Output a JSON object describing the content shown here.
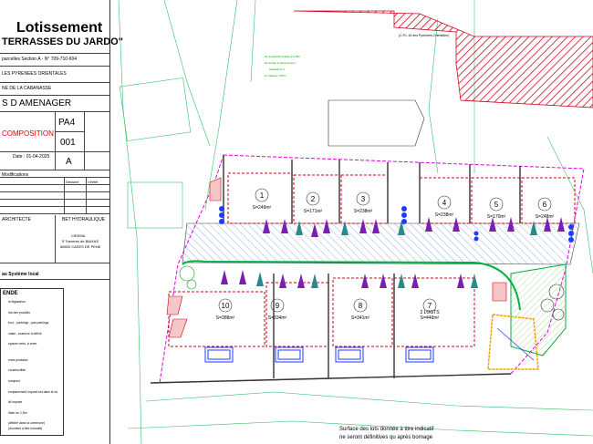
{
  "title": "Lotissement",
  "subtitle": "TERRASSES DU JARDO\"",
  "cadastre": "parcelles Section A - N° 709-710-604",
  "departement": "LES PYRENEES ORIENTALES",
  "commune": "NE DE LA CABANASSE",
  "plan_type": "S D AMENAGER",
  "plan_code": "PA4",
  "plan_subject": "COMPOSITION",
  "plan_number": "001",
  "plan_date": "Date : 01-04-2025",
  "revision": "A",
  "modifications_label": "Modifications",
  "dessine_label": "Dessiné",
  "verifie_label": "Vérifié",
  "architecte_label": "ARCHITECTE",
  "bet_label": "BET HYDRAULIQUE",
  "bet_name": "CIEEMA",
  "bet_address1": "5 Traverse de BAIXAS",
  "bet_address2": "66600 CASES DE PENE",
  "system_note": "au Système local",
  "legend_title": "ENDE",
  "legend_items": [
    "la législation",
    "",
    "nts des produits",
    "",
    "bou... parkings , pas parkings",
    "",
    "vaste - essence à définir",
    "",
    "spaces verts, à créer",
    "",
    "",
    "ones pluviales",
    "",
    "constructible",
    "",
    "compost",
    "",
    "emplacement imposé est dans le lot",
    "",
    "lid imposé",
    "",
    "lôtier en 1,5m",
    "",
    "(affiché dans la commune)",
    "(données à titre indicatif)"
  ],
  "neighbor_label": "(C.P.L.16 des Pyrénées-Orientales)",
  "green_note_1": "de la parcelle limitée à 1.25m",
  "green_note_2": "de la haie 1 Hectoire de tr",
  "green_note_3": "plantations 1",
  "green_note_4": "en hauteur 1.50m",
  "lots": [
    {
      "num": "1",
      "area": "S=249m²"
    },
    {
      "num": "2",
      "area": "S=171m²"
    },
    {
      "num": "3",
      "area": "S=238m²"
    },
    {
      "num": "4",
      "area": "S=238m²"
    },
    {
      "num": "5",
      "area": "S=170m²"
    },
    {
      "num": "6",
      "area": "S=248m²"
    },
    {
      "num": "7",
      "area": "S=449m²",
      "extra": "2 LOGTS"
    },
    {
      "num": "8",
      "area": "S=341m²"
    },
    {
      "num": "9",
      "area": "S=334m²"
    },
    {
      "num": "10",
      "area": "S=388m²"
    }
  ],
  "footer_note_1": "Surface des lots donnée à titre indicatif",
  "footer_note_2": "ne seront définitives qu après bornage",
  "colors": {
    "red_hatch": "#d0021b",
    "green_line": "#00b140",
    "magenta": "#e000e0",
    "blue": "#1e3cff",
    "purple": "#7a1fb0",
    "teal": "#2a8a8a",
    "orange": "#f0a000"
  }
}
